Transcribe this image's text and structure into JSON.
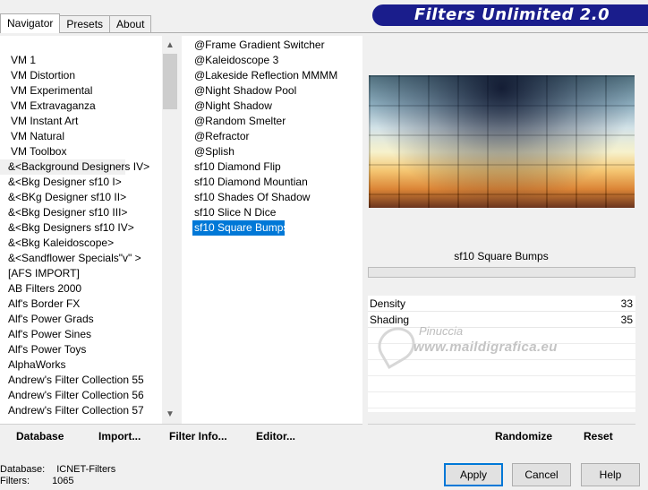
{
  "tabs": [
    {
      "label": "Navigator"
    },
    {
      "label": "Presets"
    },
    {
      "label": "About"
    }
  ],
  "banner": {
    "title": "Filters Unlimited 2.0"
  },
  "categories": [
    "VM 1",
    "VM Distortion",
    "VM Experimental",
    "VM Extravaganza",
    "VM Instant Art",
    "VM Natural",
    "VM Toolbox",
    "&<Background Designers IV>",
    "&<Bkg Designer sf10 I>",
    "&<BKg Designer sf10 II>",
    "&<Bkg Designer sf10 III>",
    "&<Bkg Designers sf10 IV>",
    "&<Bkg Kaleidoscope>",
    "&<Sandflower Specials\"v\" >",
    "[AFS IMPORT]",
    "AB Filters 2000",
    "Alf's Border FX",
    "Alf's Power Grads",
    "Alf's Power Sines",
    "Alf's Power Toys",
    "AlphaWorks",
    "Andrew's Filter Collection 55",
    "Andrew's Filter Collection 56",
    "Andrew's Filter Collection 57"
  ],
  "filters": [
    "@Frame Gradient Switcher",
    "@Kaleidoscope 3",
    "@Lakeside Reflection MMMM",
    "@Night Shadow Pool",
    "@Night Shadow",
    "@Random Smelter",
    "@Refractor",
    "@Splish",
    "sf10 Diamond Flip",
    "sf10 Diamond Mountian",
    "sf10 Shades Of Shadow",
    "sf10 Slice N Dice",
    "sf10 Square Bumps"
  ],
  "selected_filter": "sf10 Square Bumps",
  "params": [
    {
      "label": "Density",
      "value": "33"
    },
    {
      "label": "Shading",
      "value": "35"
    }
  ],
  "watermark": {
    "name": "Pinuccia",
    "url": "www.maildigrafica.eu"
  },
  "toolbar": {
    "database": "Database",
    "import": "Import...",
    "filter_info": "Filter Info...",
    "editor": "Editor...",
    "randomize": "Randomize",
    "reset": "Reset"
  },
  "footer": {
    "database_label": "Database:",
    "database_value": "ICNET-Filters",
    "filters_label": "Filters:",
    "filters_value": "1065"
  },
  "buttons": {
    "apply": "Apply",
    "cancel": "Cancel",
    "help": "Help"
  }
}
